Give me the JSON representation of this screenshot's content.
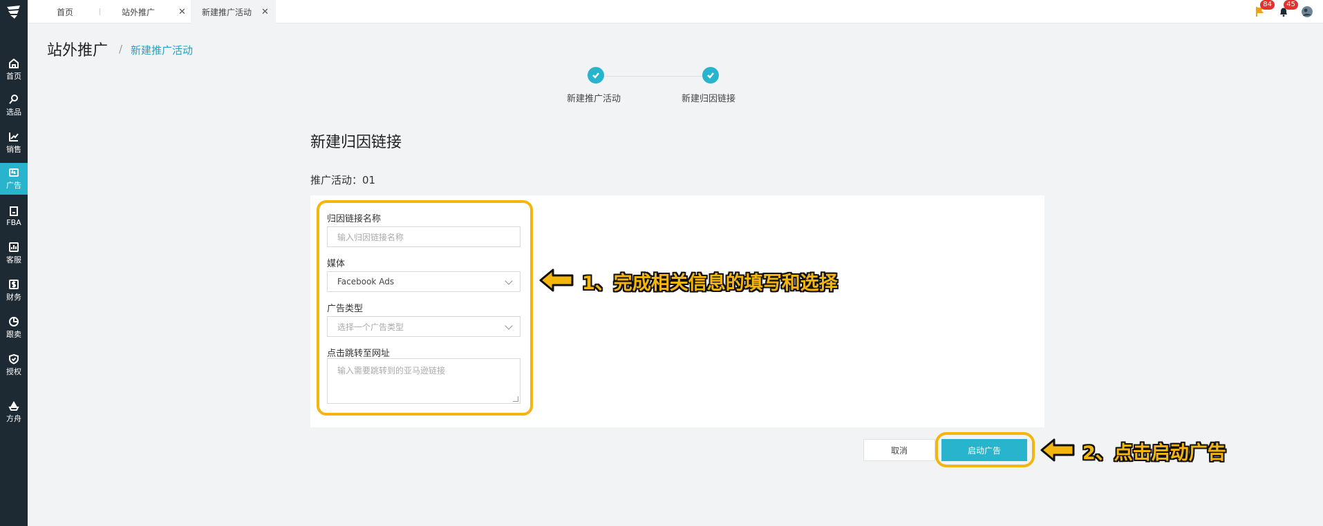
{
  "sidebar": {
    "items": [
      {
        "label": "首页",
        "icon": "home-icon"
      },
      {
        "label": "选品",
        "icon": "search-icon"
      },
      {
        "label": "销售",
        "icon": "chart-line-icon"
      },
      {
        "label": "广告",
        "icon": "ad-icon",
        "active": true
      },
      {
        "label": "FBA",
        "icon": "fba-icon"
      },
      {
        "label": "客服",
        "icon": "bar-chart-icon"
      },
      {
        "label": "财务",
        "icon": "dollar-icon"
      },
      {
        "label": "跟卖",
        "icon": "pie-chart-icon"
      },
      {
        "label": "授权",
        "icon": "shield-check-icon"
      },
      {
        "label": "方舟",
        "icon": "ark-icon"
      }
    ]
  },
  "tabs": [
    {
      "label": "首页"
    },
    {
      "label": "站外推广"
    },
    {
      "label": "新建推广活动"
    }
  ],
  "top_icons": {
    "flag_badge": "84",
    "bell_badge": "45"
  },
  "header": {
    "title": "站外推广",
    "separator": "/",
    "breadcrumb_current": "新建推广活动"
  },
  "steps": [
    {
      "label": "新建推广活动"
    },
    {
      "label": "新建归因链接"
    }
  ],
  "form": {
    "section_title": "新建归因链接",
    "campaign_label": "推广活动：01",
    "name_label": "归因链接名称",
    "name_placeholder": "输入归因链接名称",
    "media_label": "媒体",
    "media_value": "Facebook Ads",
    "ad_type_label": "广告类型",
    "ad_type_placeholder": "选择一个广告类型",
    "url_label": "点击跳转至网址",
    "url_placeholder": "输入需要跳转到的亚马逊链接"
  },
  "buttons": {
    "cancel": "取消",
    "start": "启动广告"
  },
  "annotations": {
    "step1": "1、完成相关信息的填写和选择",
    "step2": "2、点击启动广告"
  },
  "colors": {
    "accent": "#27b4cc",
    "sidebar_bg": "#1e2a33",
    "highlight": "#f4b50e",
    "badge": "#e5312f"
  }
}
